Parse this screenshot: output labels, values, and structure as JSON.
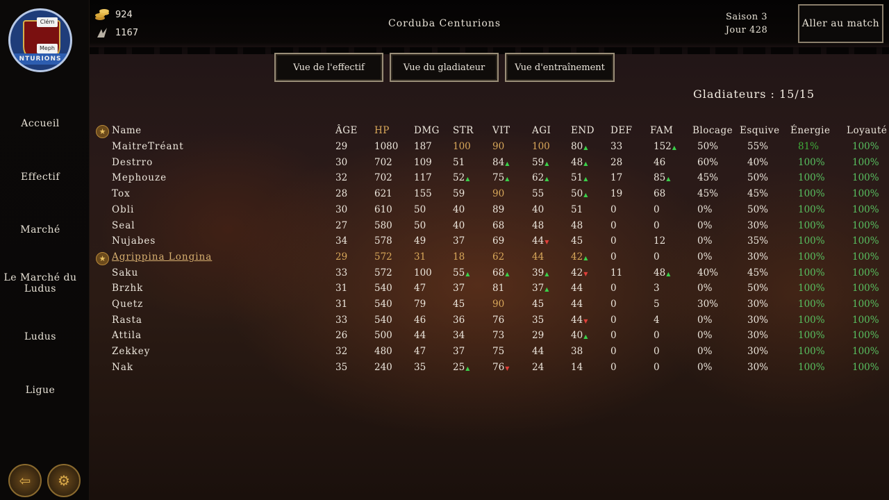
{
  "resources": {
    "gold": "924",
    "fame": "1167"
  },
  "team_name": "Corduba Centurions",
  "season": "Saison 3",
  "day": "Jour 428",
  "match_button": "Aller au match",
  "logo": {
    "band_text": "NTURIONS",
    "player_tags": [
      "Clém",
      "Meph"
    ]
  },
  "nav": [
    "Accueil",
    "Effectif",
    "Marché",
    "Le Marché du Ludus",
    "Ludus",
    "Ligue"
  ],
  "views": [
    "Vue de l'effectif",
    "Vue du gladiateur",
    "Vue d'entraînement"
  ],
  "gladiator_count": "Gladiateurs : 15/15",
  "columns": [
    "Name",
    "ÂGE",
    "HP",
    "DMG",
    "STR",
    "VIT",
    "AGI",
    "END",
    "DEF",
    "FAM",
    "Blocage",
    "Esquive",
    "Énergie",
    "Loyauté"
  ],
  "rows": [
    {
      "name": "MaitreTréant",
      "age": "29",
      "hp": "1080",
      "dmg": "187",
      "str": "100",
      "vit": "90",
      "agi": "100",
      "end": "80",
      "def": "33",
      "fam": "152",
      "blocage": "50%",
      "esquive": "55%",
      "energie": "81%",
      "loyaute": "100%"
    },
    {
      "name": "Destrro",
      "age": "30",
      "hp": "702",
      "dmg": "109",
      "str": "51",
      "vit": "84",
      "agi": "59",
      "end": "48",
      "def": "28",
      "fam": "46",
      "blocage": "60%",
      "esquive": "40%",
      "energie": "100%",
      "loyaute": "100%"
    },
    {
      "name": "Mephouze",
      "age": "32",
      "hp": "702",
      "dmg": "117",
      "str": "52",
      "vit": "75",
      "agi": "62",
      "end": "51",
      "def": "17",
      "fam": "85",
      "blocage": "45%",
      "esquive": "50%",
      "energie": "100%",
      "loyaute": "100%"
    },
    {
      "name": "Tox",
      "age": "28",
      "hp": "621",
      "dmg": "155",
      "str": "59",
      "vit": "90",
      "agi": "55",
      "end": "50",
      "def": "19",
      "fam": "68",
      "blocage": "45%",
      "esquive": "45%",
      "energie": "100%",
      "loyaute": "100%"
    },
    {
      "name": "Obli",
      "age": "30",
      "hp": "610",
      "dmg": "50",
      "str": "40",
      "vit": "89",
      "agi": "40",
      "end": "51",
      "def": "0",
      "fam": "0",
      "blocage": "0%",
      "esquive": "50%",
      "energie": "100%",
      "loyaute": "100%"
    },
    {
      "name": "Seal",
      "age": "27",
      "hp": "580",
      "dmg": "50",
      "str": "40",
      "vit": "68",
      "agi": "48",
      "end": "48",
      "def": "0",
      "fam": "0",
      "blocage": "0%",
      "esquive": "30%",
      "energie": "100%",
      "loyaute": "100%"
    },
    {
      "name": "Nujabes",
      "age": "34",
      "hp": "578",
      "dmg": "49",
      "str": "37",
      "vit": "69",
      "agi": "44",
      "end": "45",
      "def": "0",
      "fam": "12",
      "blocage": "0%",
      "esquive": "35%",
      "energie": "100%",
      "loyaute": "100%"
    },
    {
      "name": "Agrippina Longina",
      "age": "29",
      "hp": "572",
      "dmg": "31",
      "str": "18",
      "vit": "62",
      "agi": "44",
      "end": "42",
      "def": "0",
      "fam": "0",
      "blocage": "0%",
      "esquive": "30%",
      "energie": "100%",
      "loyaute": "100%"
    },
    {
      "name": "Saku",
      "age": "33",
      "hp": "572",
      "dmg": "100",
      "str": "55",
      "vit": "68",
      "agi": "39",
      "end": "42",
      "def": "11",
      "fam": "48",
      "blocage": "40%",
      "esquive": "45%",
      "energie": "100%",
      "loyaute": "100%"
    },
    {
      "name": "Brzhk",
      "age": "31",
      "hp": "540",
      "dmg": "47",
      "str": "37",
      "vit": "81",
      "agi": "37",
      "end": "44",
      "def": "0",
      "fam": "3",
      "blocage": "0%",
      "esquive": "50%",
      "energie": "100%",
      "loyaute": "100%"
    },
    {
      "name": "Quetz",
      "age": "31",
      "hp": "540",
      "dmg": "79",
      "str": "45",
      "vit": "90",
      "agi": "45",
      "end": "44",
      "def": "0",
      "fam": "5",
      "blocage": "30%",
      "esquive": "30%",
      "energie": "100%",
      "loyaute": "100%"
    },
    {
      "name": "Rasta",
      "age": "33",
      "hp": "540",
      "dmg": "46",
      "str": "36",
      "vit": "76",
      "agi": "35",
      "end": "44",
      "def": "0",
      "fam": "4",
      "blocage": "0%",
      "esquive": "30%",
      "energie": "100%",
      "loyaute": "100%"
    },
    {
      "name": "Attila",
      "age": "26",
      "hp": "500",
      "dmg": "44",
      "str": "34",
      "vit": "73",
      "agi": "29",
      "end": "40",
      "def": "0",
      "fam": "0",
      "blocage": "0%",
      "esquive": "30%",
      "energie": "100%",
      "loyaute": "100%"
    },
    {
      "name": "Zekkey",
      "age": "32",
      "hp": "480",
      "dmg": "47",
      "str": "37",
      "vit": "75",
      "agi": "44",
      "end": "38",
      "def": "0",
      "fam": "0",
      "blocage": "0%",
      "esquive": "30%",
      "energie": "100%",
      "loyaute": "100%"
    },
    {
      "name": "Nak",
      "age": "35",
      "hp": "240",
      "dmg": "35",
      "str": "25",
      "vit": "76",
      "agi": "24",
      "end": "14",
      "def": "0",
      "fam": "0",
      "blocage": "0%",
      "esquive": "30%",
      "energie": "100%",
      "loyaute": "100%"
    }
  ],
  "indicators": {
    "0": {
      "end": "up",
      "fam": "up"
    },
    "1": {
      "vit": "up",
      "agi": "up",
      "end": "up"
    },
    "2": {
      "str": "up",
      "vit": "up",
      "agi": "up",
      "end": "up",
      "fam": "up"
    },
    "3": {
      "end": "up"
    },
    "6": {
      "agi": "down"
    },
    "7": {
      "end": "up"
    },
    "8": {
      "str": "up",
      "vit": "up",
      "agi": "up",
      "end": "down",
      "fam": "up"
    },
    "9": {
      "agi": "up"
    },
    "11": {
      "end": "down"
    },
    "12": {
      "end": "up"
    },
    "14": {
      "str": "up",
      "vit": "down"
    }
  },
  "highlights": {
    "0": {
      "str": "gold",
      "vit": "gold",
      "agi": "gold"
    },
    "3": {
      "vit": "gold"
    },
    "10": {
      "vit": "gold"
    },
    "7": {
      "age": "gold",
      "hp": "gold",
      "dmg": "gold",
      "str": "gold",
      "vit": "gold",
      "agi": "gold",
      "end": "gold"
    }
  },
  "starred_rows": [
    7
  ],
  "colors": {
    "gold": "#d9a85a",
    "green": "#58c060",
    "up": "#3ad04a",
    "down": "#e0403a"
  }
}
